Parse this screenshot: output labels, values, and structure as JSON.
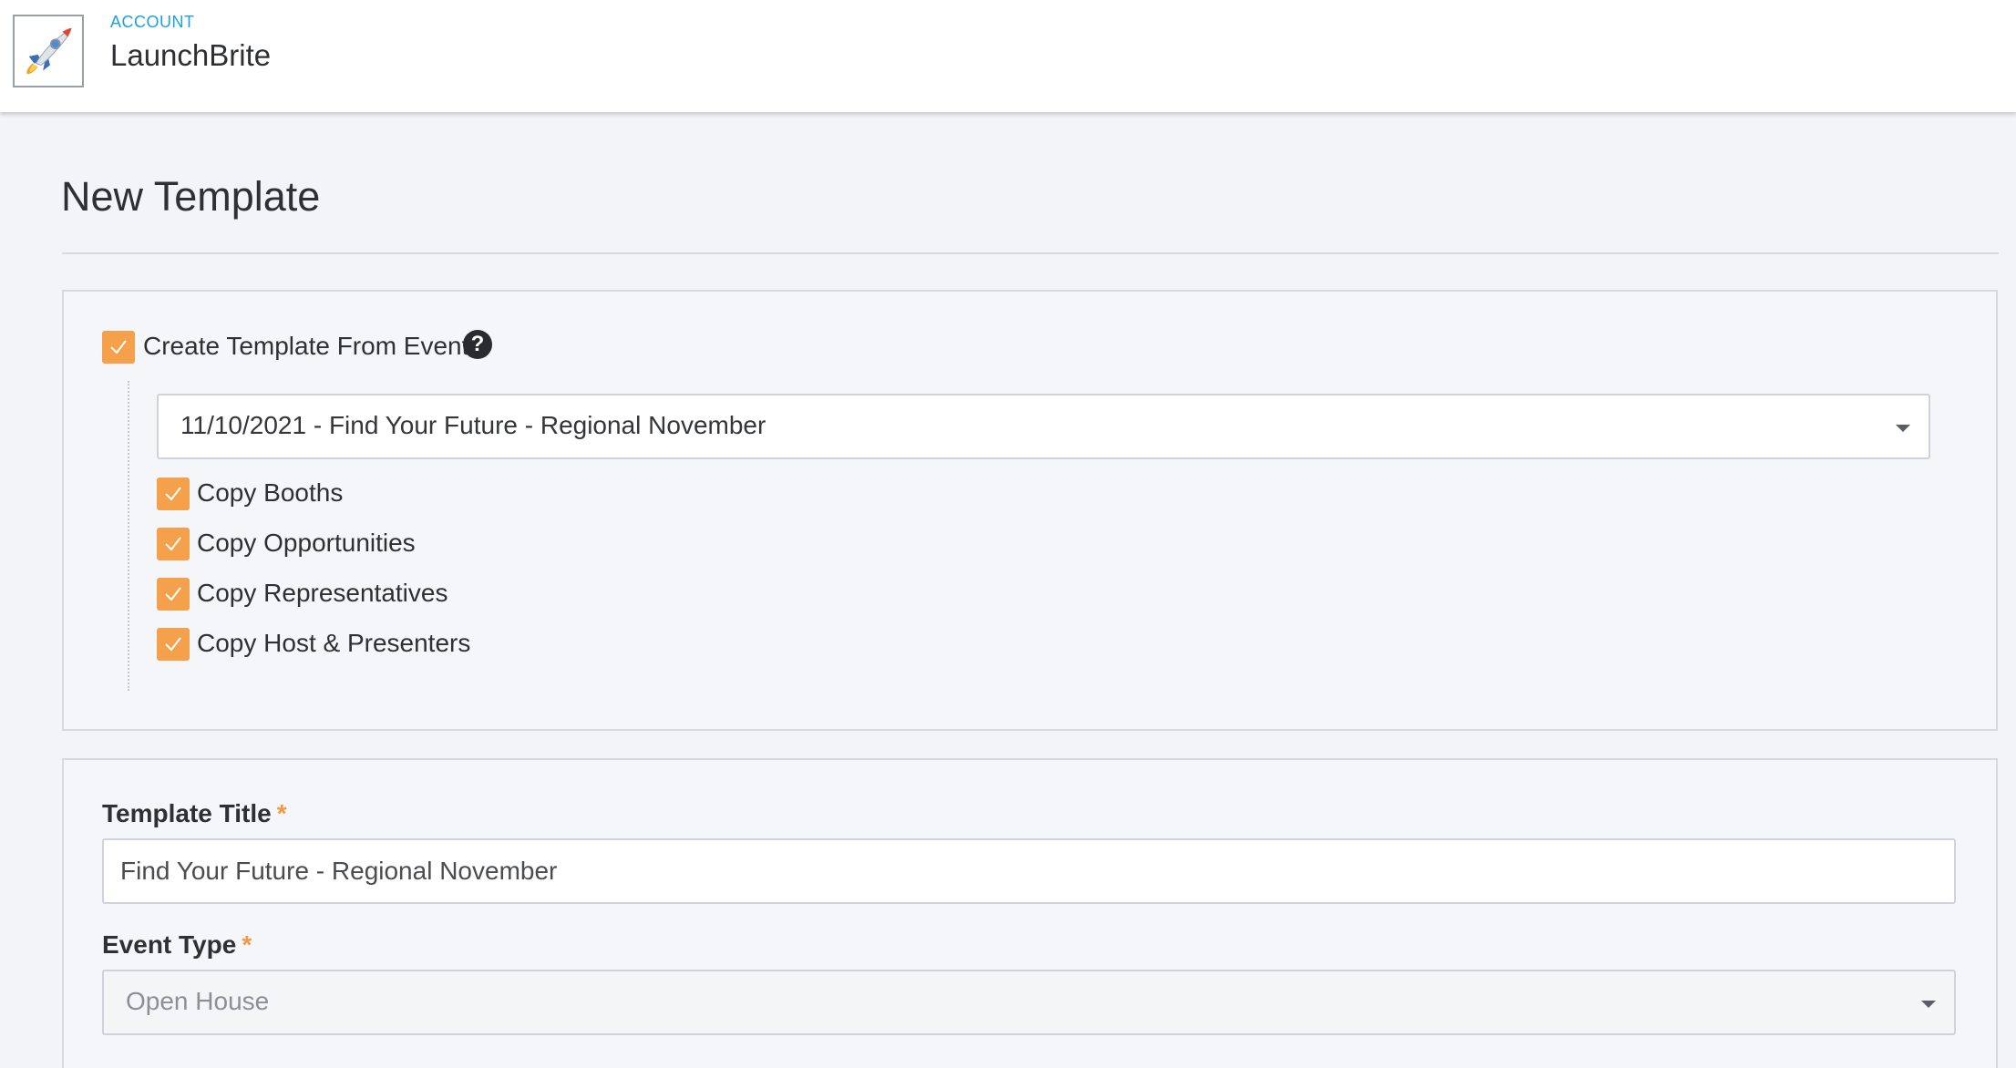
{
  "header": {
    "account_label": "ACCOUNT",
    "account_name": "LaunchBrite",
    "logo_icon": "rocket-icon"
  },
  "page": {
    "title": "New Template"
  },
  "template_from_event": {
    "checkbox_label": "Create Template From Event",
    "checked": true,
    "help_icon": "question-circle-icon",
    "event_select": {
      "value": "11/10/2021 - Find Your Future - Regional November"
    },
    "options": [
      {
        "label": "Copy Booths",
        "checked": true
      },
      {
        "label": "Copy Opportunities",
        "checked": true
      },
      {
        "label": "Copy Representatives",
        "checked": true
      },
      {
        "label": "Copy Host & Presenters",
        "checked": true
      }
    ]
  },
  "form": {
    "template_title": {
      "label": "Template Title",
      "required_mark": "*",
      "value": "Find Your Future - Regional November"
    },
    "event_type": {
      "label": "Event Type",
      "required_mark": "*",
      "value": "Open House"
    }
  },
  "colors": {
    "accent_orange": "#f5a04a",
    "link_blue": "#1aa3e0",
    "background": "#f3f4f7"
  }
}
